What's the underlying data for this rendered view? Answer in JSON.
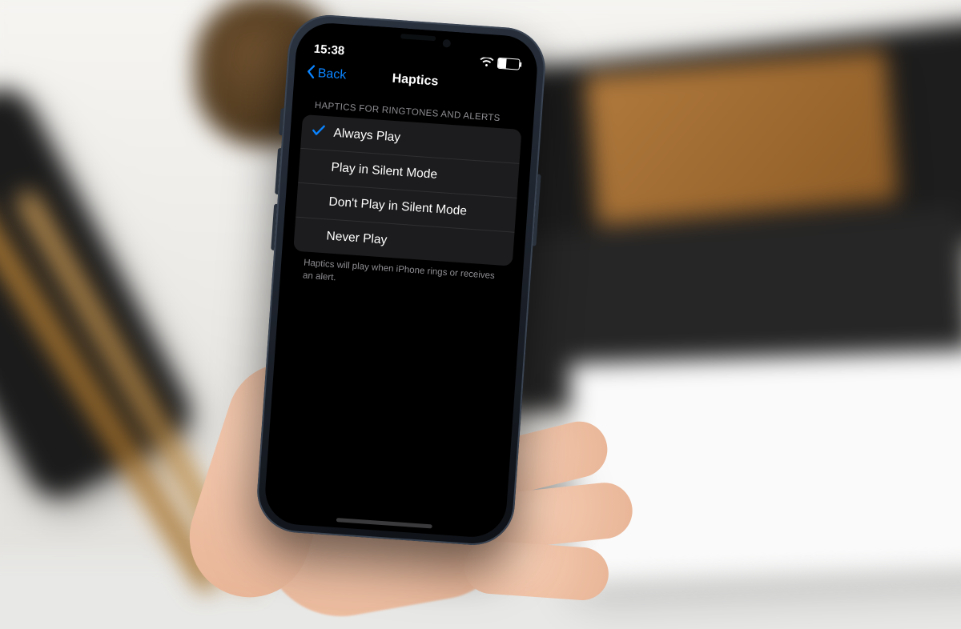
{
  "status": {
    "time": "15:38",
    "battery_percent": "39"
  },
  "nav": {
    "back_label": "Back",
    "title": "Haptics"
  },
  "section": {
    "header": "HAPTICS FOR RINGTONES AND ALERTS",
    "options": [
      {
        "label": "Always Play",
        "selected": true
      },
      {
        "label": "Play in Silent Mode",
        "selected": false
      },
      {
        "label": "Don't Play in Silent Mode",
        "selected": false
      },
      {
        "label": "Never Play",
        "selected": false
      }
    ],
    "footer": "Haptics will play when iPhone rings or receives an alert."
  },
  "colors": {
    "accent": "#0a84ff",
    "list_bg": "#1c1c1e"
  }
}
